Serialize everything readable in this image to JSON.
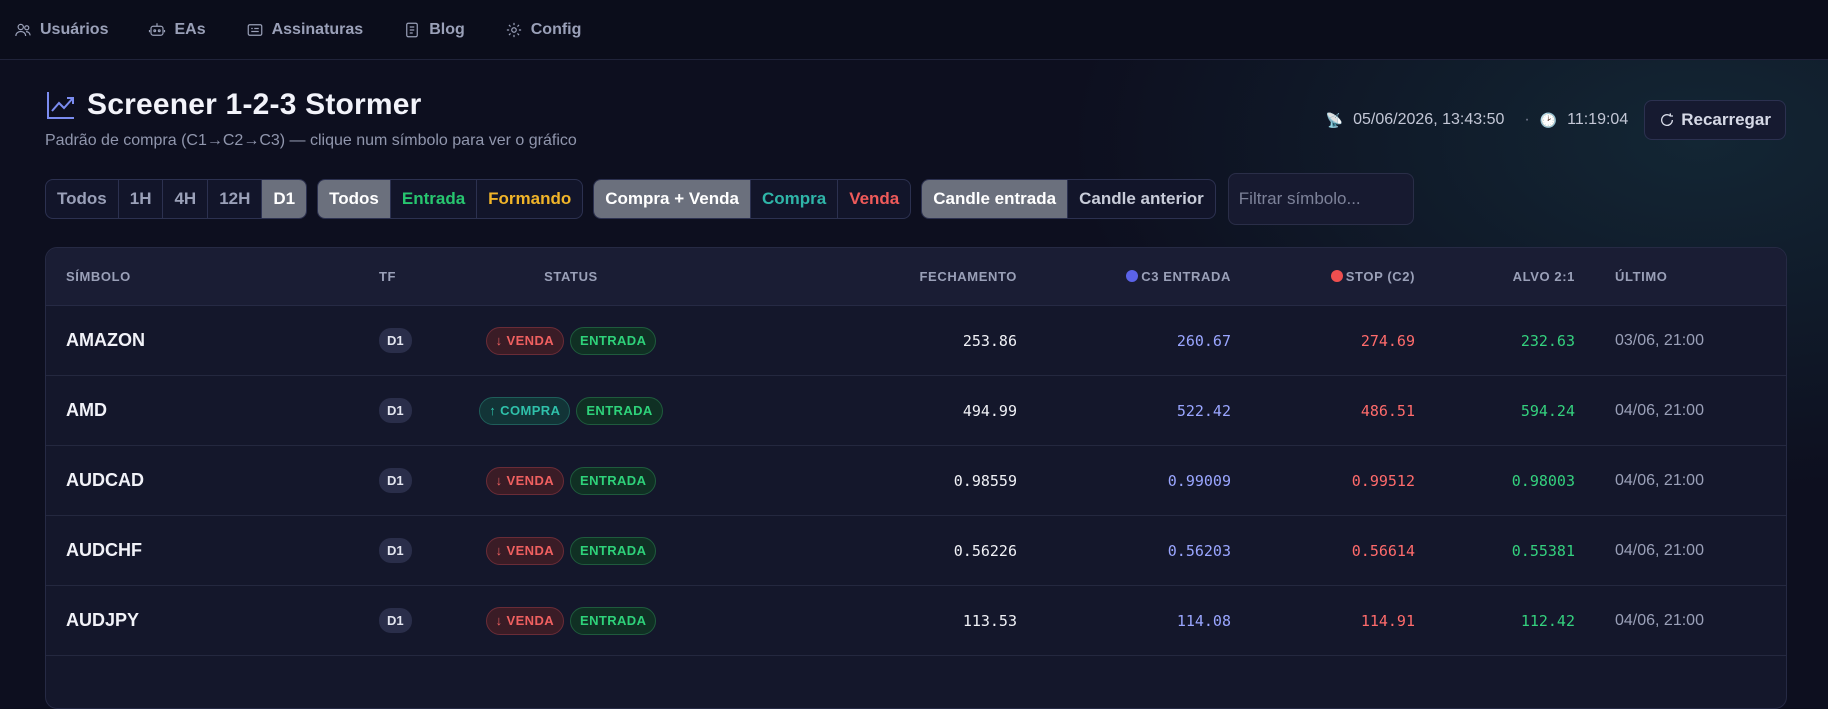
{
  "nav": {
    "items": [
      {
        "label": "Usuários",
        "icon": "users-icon"
      },
      {
        "label": "EAs",
        "icon": "robot-icon"
      },
      {
        "label": "Assinaturas",
        "icon": "card-icon"
      },
      {
        "label": "Blog",
        "icon": "doc-icon"
      },
      {
        "label": "Config",
        "icon": "gear-icon"
      }
    ]
  },
  "header": {
    "title": "Screener 1-2-3 Stormer",
    "subtitle": "Padrão de compra (C1→C2→C3) — clique num símbolo para ver o gráfico",
    "updated": "05/06/2026, 13:43:50",
    "separator": "·",
    "clock": "11:19:04",
    "reload_label": "Recarregar"
  },
  "filters": {
    "timeframes": [
      "Todos",
      "1H",
      "4H",
      "12H",
      "D1"
    ],
    "timeframe_active": "D1",
    "states": [
      "Todos",
      "Entrada",
      "Formando"
    ],
    "directions": [
      "Compra + Venda",
      "Compra",
      "Venda"
    ],
    "candles": [
      "Candle entrada",
      "Candle anterior"
    ],
    "search_placeholder": "Filtrar símbolo..."
  },
  "table": {
    "headers": {
      "symbol": "SÍMBOLO",
      "tf": "TF",
      "status": "STATUS",
      "close": "FECHAMENTO",
      "entry": "C3 ENTRADA",
      "stop": "STOP (C2)",
      "target": "ALVO 2:1",
      "last": "ÚLTIMO"
    },
    "colors": {
      "entry_dot": "#5b63e8",
      "stop_dot": "#ef4f4f"
    },
    "rows": [
      {
        "symbol": "AMAZON",
        "tf": "D1",
        "direction": "↓ VENDA",
        "dir_type": "sell",
        "state": "ENTRADA",
        "close": "253.86",
        "entry": "260.67",
        "stop": "274.69",
        "target": "232.63",
        "last": "03/06, 21:00"
      },
      {
        "symbol": "AMD",
        "tf": "D1",
        "direction": "↑ COMPRA",
        "dir_type": "buy",
        "state": "ENTRADA",
        "close": "494.99",
        "entry": "522.42",
        "stop": "486.51",
        "target": "594.24",
        "last": "04/06, 21:00"
      },
      {
        "symbol": "AUDCAD",
        "tf": "D1",
        "direction": "↓ VENDA",
        "dir_type": "sell",
        "state": "ENTRADA",
        "close": "0.98559",
        "entry": "0.99009",
        "stop": "0.99512",
        "target": "0.98003",
        "last": "04/06, 21:00"
      },
      {
        "symbol": "AUDCHF",
        "tf": "D1",
        "direction": "↓ VENDA",
        "dir_type": "sell",
        "state": "ENTRADA",
        "close": "0.56226",
        "entry": "0.56203",
        "stop": "0.56614",
        "target": "0.55381",
        "last": "04/06, 21:00"
      },
      {
        "symbol": "AUDJPY",
        "tf": "D1",
        "direction": "↓ VENDA",
        "dir_type": "sell",
        "state": "ENTRADA",
        "close": "113.53",
        "entry": "114.08",
        "stop": "114.91",
        "target": "112.42",
        "last": "04/06, 21:00"
      }
    ]
  }
}
